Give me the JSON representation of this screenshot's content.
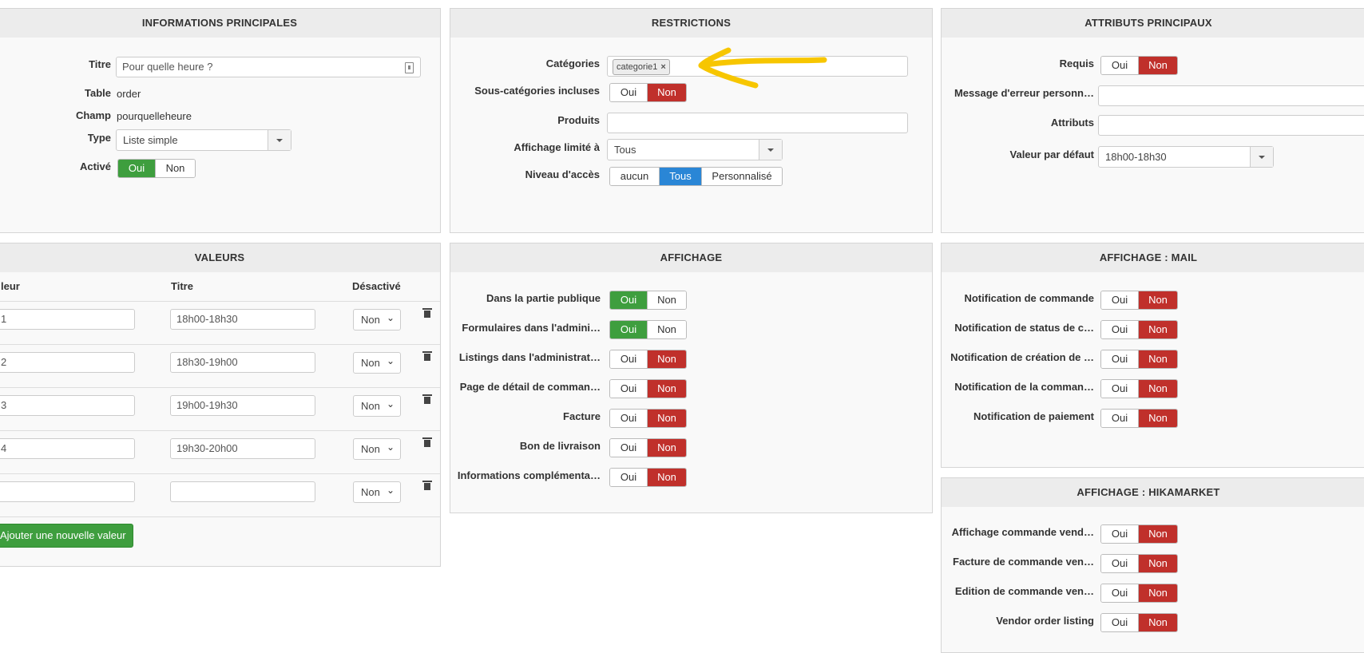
{
  "main_info": {
    "header": "INFORMATIONS PRINCIPALES",
    "titre_label": "Titre",
    "titre_value": "Pour quelle heure ?",
    "table_label": "Table",
    "table_value": "order",
    "champ_label": "Champ",
    "champ_value": "pourquelleheure",
    "type_label": "Type",
    "type_value": "Liste simple",
    "active_label": "Activé",
    "oui": "Oui",
    "non": "Non",
    "active_selected": "Oui"
  },
  "restrictions": {
    "header": "RESTRICTIONS",
    "categories_label": "Catégories",
    "category_tag": "categorie1",
    "subcats_label": "Sous-catégories incluses",
    "oui": "Oui",
    "non": "Non",
    "subcats_selected": "Non",
    "produits_label": "Produits",
    "affichage_label": "Affichage limité à",
    "affichage_value": "Tous",
    "niveau_label": "Niveau d'accès",
    "niveau_options": [
      "aucun",
      "Tous",
      "Personnalisé"
    ],
    "niveau_selected": "Tous"
  },
  "attributs": {
    "header": "ATTRIBUTS PRINCIPAUX",
    "requis_label": "Requis",
    "oui": "Oui",
    "non": "Non",
    "requis_selected": "Non",
    "message_label": "Message d'erreur personn…",
    "attributs_label": "Attributs",
    "defaut_label": "Valeur par défaut",
    "defaut_value": "18h00-18h30"
  },
  "valeurs": {
    "header": "VALEURS",
    "col_valeur": "leur",
    "col_titre": "Titre",
    "col_desactive": "Désactivé",
    "rows": [
      {
        "valeur": "1",
        "titre": "18h00-18h30",
        "desactive": "Non"
      },
      {
        "valeur": "2",
        "titre": "18h30-19h00",
        "desactive": "Non"
      },
      {
        "valeur": "3",
        "titre": "19h00-19h30",
        "desactive": "Non"
      },
      {
        "valeur": "4",
        "titre": "19h30-20h00",
        "desactive": "Non"
      },
      {
        "valeur": "",
        "titre": "",
        "desactive": "Non"
      }
    ],
    "add_button": "Ajouter une nouvelle valeur"
  },
  "affichage": {
    "header": "AFFICHAGE",
    "oui": "Oui",
    "non": "Non",
    "rows": [
      {
        "label": "Dans la partie publique",
        "selected": "Oui"
      },
      {
        "label": "Formulaires dans l'admini…",
        "selected": "Oui"
      },
      {
        "label": "Listings dans l'administrat…",
        "selected": "Non"
      },
      {
        "label": "Page de détail de comman…",
        "selected": "Non"
      },
      {
        "label": "Facture",
        "selected": "Non"
      },
      {
        "label": "Bon de livraison",
        "selected": "Non"
      },
      {
        "label": "Informations complémenta…",
        "selected": "Non"
      }
    ]
  },
  "affichage_mail": {
    "header": "AFFICHAGE : MAIL",
    "oui": "Oui",
    "non": "Non",
    "rows": [
      {
        "label": "Notification de commande",
        "selected": "Non"
      },
      {
        "label": "Notification de status de c…",
        "selected": "Non"
      },
      {
        "label": "Notification de création de …",
        "selected": "Non"
      },
      {
        "label": "Notification de la comman…",
        "selected": "Non"
      },
      {
        "label": "Notification de paiement",
        "selected": "Non"
      }
    ]
  },
  "affichage_hikamarket": {
    "header": "AFFICHAGE : HIKAMARKET",
    "oui": "Oui",
    "non": "Non",
    "rows": [
      {
        "label": "Affichage commande vend…",
        "selected": "Non"
      },
      {
        "label": "Facture de commande ven…",
        "selected": "Non"
      },
      {
        "label": "Edition de commande ven…",
        "selected": "Non"
      },
      {
        "label": "Vendor order listing",
        "selected": "Non"
      }
    ]
  },
  "annotation": {
    "color": "#f7c600"
  }
}
